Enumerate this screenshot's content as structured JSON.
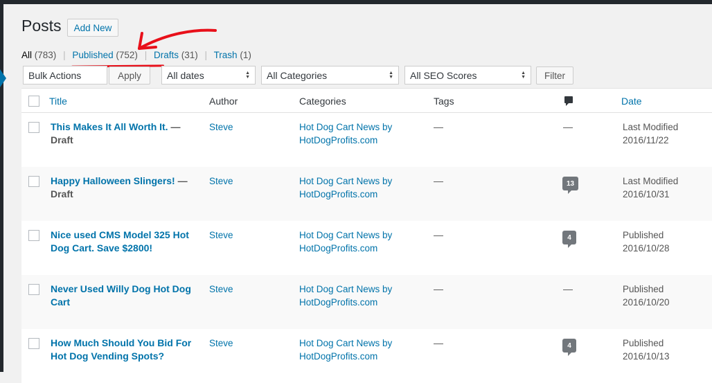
{
  "page": {
    "title": "Posts",
    "add_new": "Add New"
  },
  "views": {
    "all": {
      "label": "All",
      "count": "(783)"
    },
    "published": {
      "label": "Published",
      "count": "(752)"
    },
    "drafts": {
      "label": "Drafts",
      "count": "(31)"
    },
    "trash": {
      "label": "Trash",
      "count": "(1)"
    },
    "separator": "|"
  },
  "filters": {
    "bulk_actions": "Bulk Actions",
    "apply": "Apply",
    "dates": "All dates",
    "categories": "All Categories",
    "seo_scores": "All SEO Scores",
    "filter": "Filter"
  },
  "columns": {
    "title": "Title",
    "author": "Author",
    "categories": "Categories",
    "tags": "Tags",
    "comments_icon": "comment-bubble-icon",
    "date": "Date"
  },
  "posts": [
    {
      "title": "This Makes It All Worth It.",
      "state": "— Draft",
      "author": "Steve",
      "categories": "Hot Dog Cart News by HotDogProfits.com",
      "tags": "—",
      "comments": "—",
      "date_status": "Last Modified",
      "date": "2016/11/22"
    },
    {
      "title": "Happy Halloween Slingers!",
      "state": "— Draft",
      "author": "Steve",
      "categories": "Hot Dog Cart News by HotDogProfits.com",
      "tags": "—",
      "comments": "13",
      "date_status": "Last Modified",
      "date": "2016/10/31"
    },
    {
      "title": "Nice used CMS Model 325 Hot Dog Cart. Save $2800!",
      "state": "",
      "author": "Steve",
      "categories": "Hot Dog Cart News by HotDogProfits.com",
      "tags": "—",
      "comments": "4",
      "date_status": "Published",
      "date": "2016/10/28"
    },
    {
      "title": "Never Used Willy Dog Hot Dog Cart",
      "state": "",
      "author": "Steve",
      "categories": "Hot Dog Cart News by HotDogProfits.com",
      "tags": "—",
      "comments": "—",
      "date_status": "Published",
      "date": "2016/10/20"
    },
    {
      "title": "How Much Should You Bid For Hot Dog Vending Spots?",
      "state": "",
      "author": "Steve",
      "categories": "Hot Dog Cart News by HotDogProfits.com",
      "tags": "—",
      "comments": "4",
      "date_status": "Published",
      "date": "2016/10/13"
    }
  ],
  "annotation": {
    "color": "#e8101a",
    "shape": "red-hand-drawn-arrow",
    "target": "Published"
  },
  "colors": {
    "link": "#0073aa",
    "text": "#23282d",
    "admin_bar": "#23282d",
    "comment_bubble": "#72777c"
  }
}
